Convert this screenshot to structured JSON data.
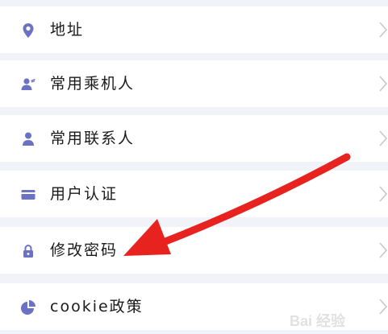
{
  "menu": {
    "items": [
      {
        "label": "地址",
        "icon": "location-pin-icon"
      },
      {
        "label": "常用乘机人",
        "icon": "passenger-icon"
      },
      {
        "label": "常用联系人",
        "icon": "contact-person-icon"
      },
      {
        "label": "用户认证",
        "icon": "id-card-icon"
      },
      {
        "label": "修改密码",
        "icon": "lock-icon"
      },
      {
        "label": "cookie政策",
        "icon": "pie-chart-icon"
      }
    ]
  },
  "colors": {
    "icon": "#6b72c4",
    "arrow": "#e8231f",
    "row_background": "#ffffff",
    "page_background": "#f1f3f8",
    "chevron": "#c8c8c8"
  },
  "watermark": {
    "text": "Bai 经验"
  }
}
